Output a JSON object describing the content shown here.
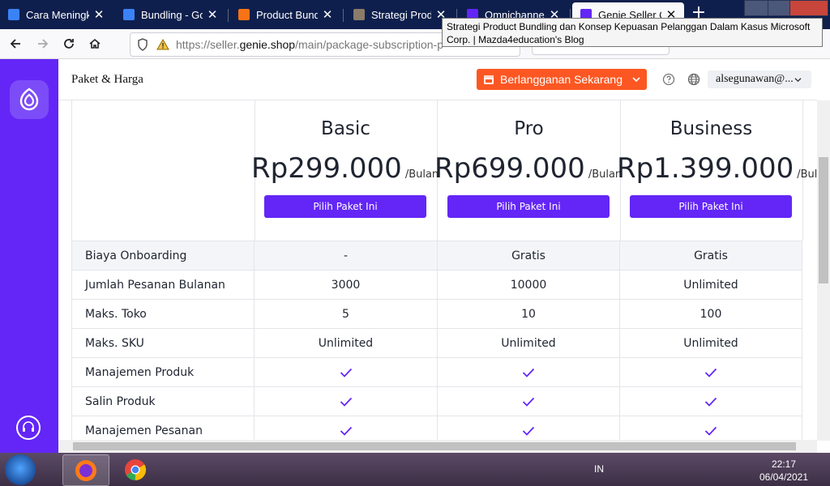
{
  "browser": {
    "tabs": [
      {
        "title": "Cara Meningkatkan",
        "favicon_color": "#3b82f6"
      },
      {
        "title": "Bundling - Goo",
        "favicon_color": "#3b82f6"
      },
      {
        "title": "Product Bundlin",
        "favicon_color": "#f97316"
      },
      {
        "title": "Strategi Produc",
        "favicon_color": "#8a7b6a"
      },
      {
        "title": "Omnichannel S",
        "favicon_color": "#6326f6"
      },
      {
        "title": "Genie Seller Ce",
        "favicon_color": "#6326f6"
      }
    ],
    "active_tab_index": 5,
    "tooltip": "Strategi Product Bundling dan Konsep Kepuasan Pelanggan Dalam Kasus Microsoft Corp. | Mazda4education's Blog",
    "url": {
      "prefix": "https://seller.",
      "domain": "genie.shop",
      "path": "/main/package-subscription-p"
    }
  },
  "app": {
    "page_title": "Paket & Harga",
    "subscribe_button": "Berlangganan Sekarang",
    "user_menu": "alsegunawan@...",
    "accent_color": "#6326f6",
    "cta_color": "#fc5722"
  },
  "plans": [
    {
      "name": "Basic",
      "price": "Rp299.000",
      "period": "/Bulan",
      "button": "Pilih Paket Ini"
    },
    {
      "name": "Pro",
      "price": "Rp699.000",
      "period": "/Bulan",
      "button": "Pilih Paket Ini"
    },
    {
      "name": "Business",
      "price": "Rp1.399.000",
      "period": "/Bulan",
      "button": "Pilih Paket Ini"
    }
  ],
  "features": [
    {
      "label": "Biaya Onboarding",
      "values": [
        "-",
        "Gratis",
        "Gratis"
      ],
      "highlight": true
    },
    {
      "label": "Jumlah Pesanan Bulanan",
      "values": [
        "3000",
        "10000",
        "Unlimited"
      ]
    },
    {
      "label": "Maks. Toko",
      "values": [
        "5",
        "10",
        "100"
      ]
    },
    {
      "label": "Maks. SKU",
      "values": [
        "Unlimited",
        "Unlimited",
        "Unlimited"
      ]
    },
    {
      "label": "Manajemen Produk",
      "values": [
        "check",
        "check",
        "check"
      ]
    },
    {
      "label": "Salin Produk",
      "values": [
        "check",
        "check",
        "check"
      ]
    },
    {
      "label": "Manajemen Pesanan",
      "values": [
        "check",
        "check",
        "check"
      ]
    }
  ],
  "taskbar": {
    "language": "IN",
    "time": "22:17",
    "date": "06/04/2021"
  }
}
